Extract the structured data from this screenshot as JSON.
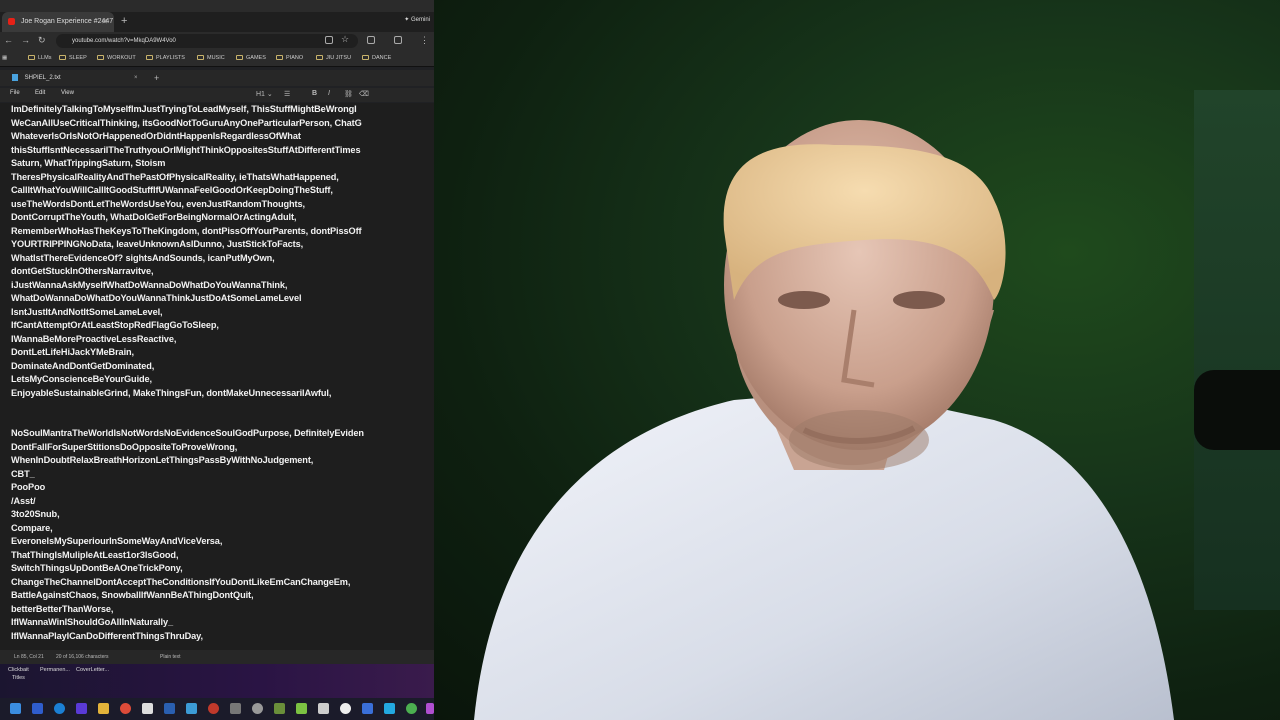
{
  "browser": {
    "tab_title": "Joe Rogan Experience #2447 - ...",
    "gemini_label": "Gemini",
    "url": "youtube.com/watch?v=MkqDA9W4Vo0",
    "bookmarks": [
      "LLMs",
      "SLEEP",
      "WORKOUT",
      "PLAYLISTS",
      "MUSIC",
      "GAMES",
      "PIANO",
      "JIU JITSU",
      "DANCE"
    ]
  },
  "notepad": {
    "tab_title": "SHPIEL_2.txt",
    "menu": [
      "File",
      "Edit",
      "View"
    ],
    "toolbar_heading": "H1",
    "status": {
      "position": "Ln 85, Col 21",
      "chars": "20 of 16,106 characters",
      "format": "Plain text"
    },
    "lines": [
      "ImDefinitelyTalkingToMyselfImJustTryingToLeadMyself, ThisStuffMightBeWrongI",
      "WeCanAllUseCriticalThinking, itsGoodNotToGuruAnyOneParticularPerson,  ChatG",
      "WhateverIsOrIsNotOrHappenedOrDidntHappenIsRegardlessOfWhat",
      "thisStuffIsntNecessarilTheTruthyouOrIMightThinkOppositesStuffAtDifferentTimes",
      "Saturn, WhatTrippingSaturn, Stoism",
      "TheresPhysicalRealityAndThePastOfPhysicalReality, ieThatsWhatHappened,",
      "CallItWhatYouWillCallItGoodStuffIfUWannaFeelGoodOrKeepDoingTheStuff,",
      "useTheWordsDontLetTheWordsUseYou, evenJustRandomThoughts,",
      "DontCorruptTheYouth, WhatDoIGetForBeingNormalOrActingAdult,",
      "RememberWhoHasTheKeysToTheKingdom, dontPissOffYourParents, dontPissOff",
      "YOURTRIPPINGNoData, leaveUnknownAsIDunno, JustStickToFacts,",
      "WhatIstThereEvidenceOf? sightsAndSounds, icanPutMyOwn,",
      "dontGetStuckInOthersNarravitve,",
      "iJustWannaAskMyselfWhatDoWannaDoWhatDoYouWannaThink,",
      "WhatDoWannaDoWhatDoYouWannaThinkJustDoAtSomeLameLevel",
      "IsntJustItAndNotItSomeLameLevel,",
      "IfCantAttemptOrAtLeastStopRedFlagGoToSleep,",
      "IWannaBeMoreProactiveLessReactive,",
      "DontLetLifeHiJackYMeBrain,",
      "DominateAndDontGetDominated,",
      "LetsMyConscienceBeYourGuide,",
      "EnjoyableSustainableGrind, MakeThingsFun, dontMakeUnnecessarilAwful,",
      "",
      "",
      "NoSoulMantraTheWorldIsNotWordsNoEvidenceSoulGodPurpose, DefinitelyEviden",
      "DontFallForSuperStitionsDoOppositeToProveWrong,",
      "WhenInDoubtRelaxBreathHorizonLetThingsPassByWithNoJudgement,",
      "CBT_",
      "PooPoo",
      "/Asst/",
      "3to20Snub,",
      "Compare,",
      "EveroneIsMySuperiourInSomeWayAndViceVersa,",
      "ThatThingIsMulipleAtLeast1or3IsGood,",
      "SwitchThingsUpDontBeAOneTrickPony,",
      "ChangeTheChannelDontAcceptTheConditionsIfYouDontLikeEmCanChangeEm,",
      "BattleAgainstChaos, SnowballIfWannBeAThingDontQuit,",
      "betterBetterThanWorse,",
      "IfIWannaWinIShouldGoAllInNaturally_",
      "IfIWannaPlayICanDoDifferentThingsThruDay,"
    ]
  },
  "dock": {
    "items": [
      "Clickbait",
      "Permanen...",
      "CoverLetter..."
    ],
    "second_row": "Titles"
  },
  "colors": {
    "editor_bg": "#1e1e1e",
    "editor_text": "#f2f2f2",
    "youtube_red": "#e62117"
  }
}
